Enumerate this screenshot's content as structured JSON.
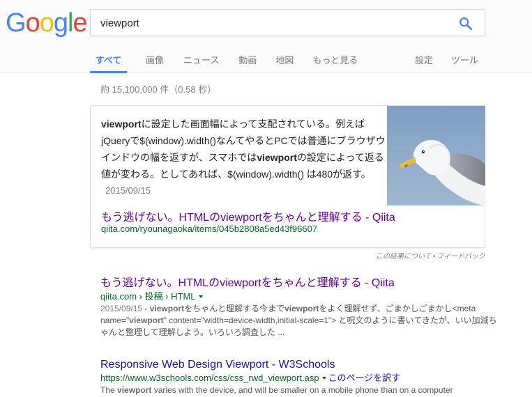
{
  "logo": {
    "letters": [
      "G",
      "o",
      "o",
      "g",
      "l",
      "e"
    ],
    "colors": [
      "#4285f4",
      "#ea4335",
      "#fbbc05",
      "#4285f4",
      "#34a853",
      "#ea4335"
    ]
  },
  "search": {
    "query": "viewport",
    "button_color": "#4285f4"
  },
  "tabs": [
    {
      "label": "すべて",
      "active": true
    },
    {
      "label": "画像"
    },
    {
      "label": "ニュース"
    },
    {
      "label": "動画"
    },
    {
      "label": "地図"
    },
    {
      "label": "もっと見る"
    }
  ],
  "tools": {
    "settings": "設定",
    "tools": "ツール"
  },
  "stats": "約 15,100,000 件（0.58 秒）",
  "snippet": {
    "line1_bold": "viewport",
    "line1_rest": "に設定した画面幅によって支配されている。例えば",
    "line2": "jQueryで$(window).width()なんてやるとPCでは普通にブラウザウ",
    "line3_pre": "インドウの幅を返すが、スマホでは",
    "line3_bold": "viewport",
    "line3_rest": "の設定によって返る",
    "line4": "値が変わる。としてあれば、$(window).width() は480が返す。",
    "date": "2015/09/15",
    "title": "もう逃げない。HTMLのviewportをちゃんと理解する - Qiita",
    "url": "qiita.com/ryounagaoka/items/045b2808a5ed43f96607"
  },
  "feedback": {
    "about": "この結果について",
    "sep": "•",
    "feedback": "フィードバック"
  },
  "results": [
    {
      "title": "もう逃げない。HTMLのviewportをちゃんと理解する - Qiita",
      "cite": "qiita.com › 投稿 › HTML",
      "date": "2015/09/15",
      "desc_parts": [
        {
          "t": " - ",
          "b": false
        },
        {
          "t": "viewport",
          "b": true
        },
        {
          "t": "をちゃんと理解する今まで",
          "b": false
        },
        {
          "t": "viewport",
          "b": true
        },
        {
          "t": "をよく理解せず、ごまかしごまかし<meta name=\"",
          "b": false
        },
        {
          "t": "viewport",
          "b": true
        },
        {
          "t": "\" content=\"width=device-width,initial-scale=1\"> と呪文のように書いてきたが、いい加減ちゃんと整理して理解しよう。いろいろ調査した ...",
          "b": false
        }
      ]
    },
    {
      "title": "Responsive Web Design Viewport - W3Schools",
      "cite": "https://www.w3schools.com/css/css_rwd_viewport.asp",
      "translate": "このページを訳す",
      "desc_parts": [
        {
          "t": "The ",
          "b": false
        },
        {
          "t": "viewport",
          "b": true
        },
        {
          "t": " varies with the device, and will be smaller on a mobile phone than on a computer",
          "b": false
        }
      ]
    }
  ]
}
